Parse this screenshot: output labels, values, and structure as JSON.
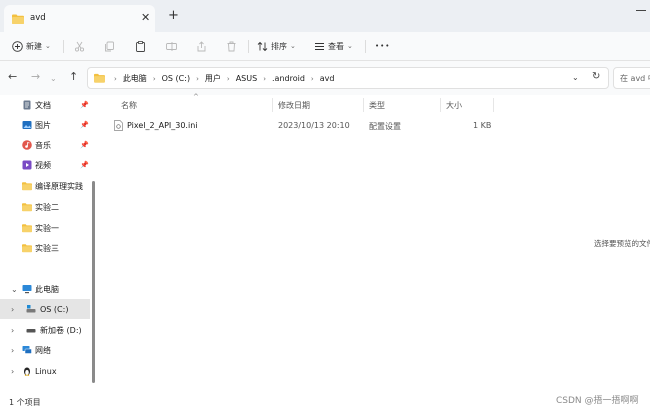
{
  "tab": {
    "title": "avd",
    "close_glyph": "✕",
    "new_glyph": "+"
  },
  "toolbar": {
    "new_label": "新建",
    "sort_label": "排序",
    "view_label": "查看",
    "more_glyph": "•••"
  },
  "nav": {
    "back": "←",
    "forward": "→",
    "up": "↑"
  },
  "breadcrumb": [
    "此电脑",
    "OS (C:)",
    "用户",
    "ASUS",
    ".android",
    "avd"
  ],
  "breadcrumb_sep": "›",
  "search": {
    "placeholder": "在 avd 中"
  },
  "sidebar": {
    "quick": [
      {
        "label": "文档",
        "icon": "documents-icon"
      },
      {
        "label": "图片",
        "icon": "pictures-icon"
      },
      {
        "label": "音乐",
        "icon": "music-icon"
      },
      {
        "label": "视频",
        "icon": "videos-icon"
      },
      {
        "label": "编译原理实践",
        "icon": "folder-icon"
      },
      {
        "label": "实验二",
        "icon": "folder-icon"
      },
      {
        "label": "实验一",
        "icon": "folder-icon"
      },
      {
        "label": "实验三",
        "icon": "folder-icon"
      }
    ],
    "tree": [
      {
        "label": "此电脑",
        "icon": "this-pc-icon"
      },
      {
        "label": "OS (C:)",
        "icon": "drive-c-icon"
      },
      {
        "label": "新加卷 (D:)",
        "icon": "drive-d-icon"
      },
      {
        "label": "网络",
        "icon": "network-icon"
      },
      {
        "label": "Linux",
        "icon": "linux-icon"
      }
    ]
  },
  "columns": {
    "name": "名称",
    "date": "修改日期",
    "type": "类型",
    "size": "大小"
  },
  "files": [
    {
      "name": "Pixel_2_API_30.ini",
      "date": "2023/10/13 20:10",
      "type": "配置设置",
      "size": "1 KB"
    }
  ],
  "preview_text": "选择要预览的文件",
  "status": {
    "count": "1 个项目"
  },
  "watermark": "CSDN @捂一捂啊啊",
  "colors": {
    "folder": "#f3c040",
    "accent": "#0067c0",
    "selection": "#e5e5e5"
  }
}
